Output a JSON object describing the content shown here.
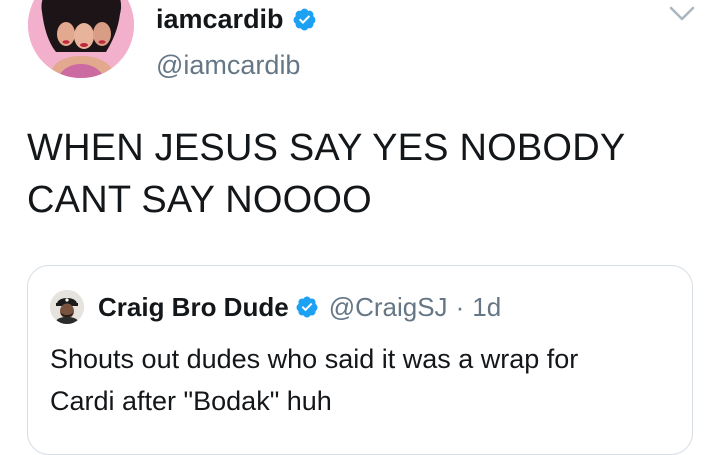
{
  "author": {
    "display_name": "iamcardib",
    "handle": "@iamcardib",
    "verified": true
  },
  "tweet": {
    "text": "WHEN JESUS SAY YES NOBODY\nCANT SAY NOOOO"
  },
  "quoted_tweet": {
    "display_name": "Craig Bro Dude",
    "handle": "@CraigSJ",
    "separator": "·",
    "time": "1d",
    "verified": true,
    "text": "Shouts out dudes who said it was a wrap for\nCardi after \"Bodak\" huh"
  },
  "icons": {
    "verified": "verified-badge-icon",
    "menu": "chevron-down-icon"
  },
  "colors": {
    "verified_blue": "#1da1f2",
    "secondary_text": "#657786",
    "primary_text": "#14171a",
    "border": "#d6dde3"
  }
}
